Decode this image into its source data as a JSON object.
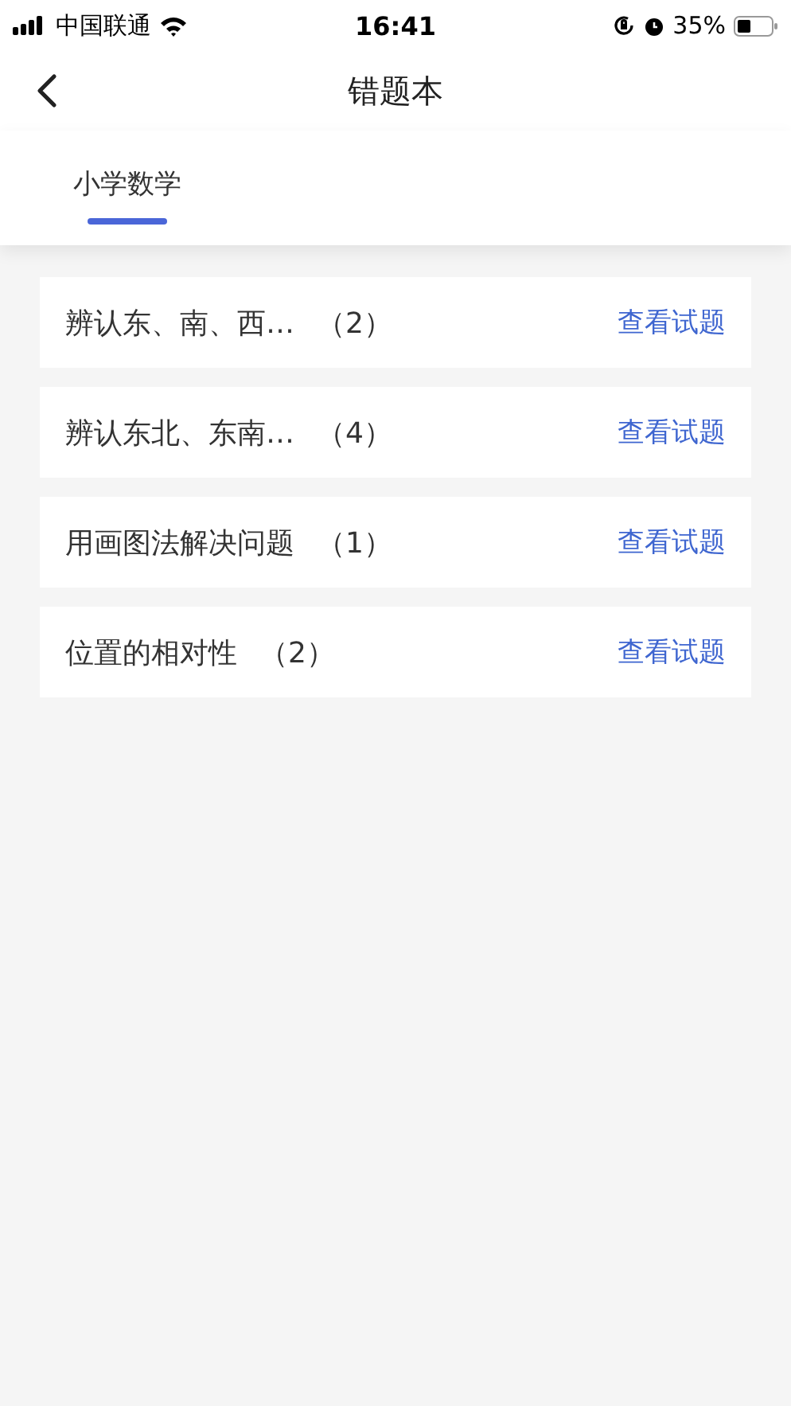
{
  "status_bar": {
    "carrier": "中国联通",
    "time": "16:41",
    "battery": "35%"
  },
  "nav": {
    "title": "错题本"
  },
  "tabs": [
    {
      "label": "小学数学",
      "selected": true
    }
  ],
  "items": [
    {
      "title": "辨认东、南、西…",
      "count": "（2）",
      "action": "查看试题"
    },
    {
      "title": "辨认东北、东南…",
      "count": "（4）",
      "action": "查看试题"
    },
    {
      "title": "用画图法解决问题",
      "count": "（1）",
      "action": "查看试题"
    },
    {
      "title": "位置的相对性",
      "count": "（2）",
      "action": "查看试题"
    }
  ]
}
